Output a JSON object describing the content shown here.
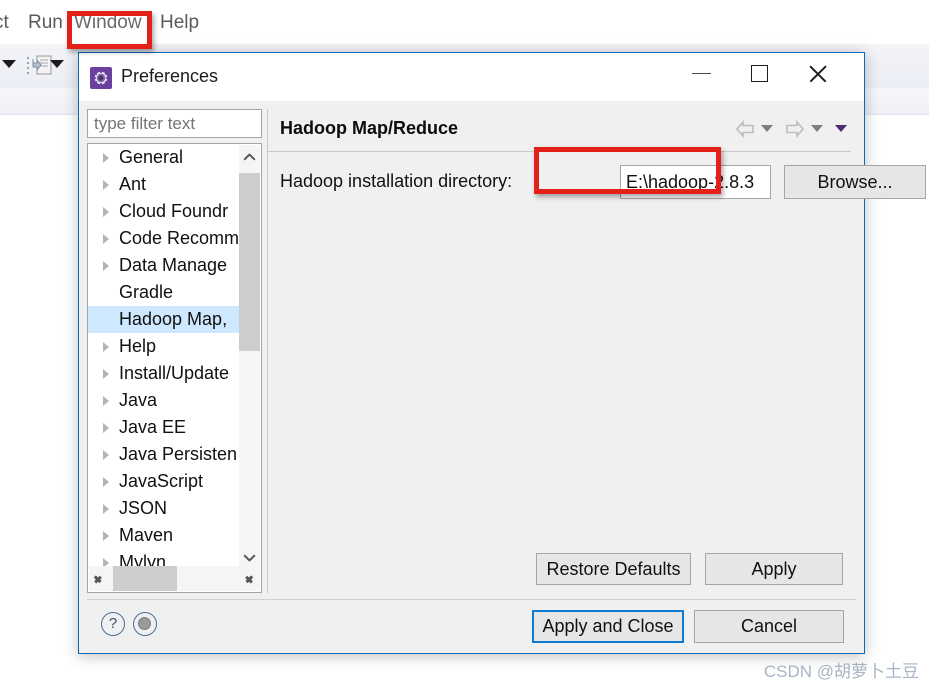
{
  "ide": {
    "menus": [
      {
        "label": "ct",
        "name": "menu-project"
      },
      {
        "label": "Run",
        "name": "menu-run"
      },
      {
        "label": "Window",
        "name": "menu-window"
      },
      {
        "label": "Help",
        "name": "menu-help"
      }
    ]
  },
  "dialog": {
    "title": "Preferences",
    "icon": "gear-icon",
    "window_controls": {
      "minimize": "minimize-icon",
      "maximize": "maximize-icon",
      "close": "close-icon"
    },
    "filter": {
      "placeholder": "type filter text",
      "value": ""
    },
    "tree": {
      "items": [
        {
          "label": "General",
          "expandable": true,
          "selected": false
        },
        {
          "label": "Ant",
          "expandable": true,
          "selected": false
        },
        {
          "label": "Cloud Foundr",
          "expandable": true,
          "selected": false
        },
        {
          "label": "Code Recomm",
          "expandable": true,
          "selected": false
        },
        {
          "label": "Data Manage",
          "expandable": true,
          "selected": false
        },
        {
          "label": "Gradle",
          "expandable": false,
          "selected": false
        },
        {
          "label": "Hadoop Map,",
          "expandable": false,
          "selected": true
        },
        {
          "label": "Help",
          "expandable": true,
          "selected": false
        },
        {
          "label": "Install/Update",
          "expandable": true,
          "selected": false
        },
        {
          "label": "Java",
          "expandable": true,
          "selected": false
        },
        {
          "label": "Java EE",
          "expandable": true,
          "selected": false
        },
        {
          "label": "Java Persisten",
          "expandable": true,
          "selected": false
        },
        {
          "label": "JavaScript",
          "expandable": true,
          "selected": false
        },
        {
          "label": "JSON",
          "expandable": true,
          "selected": false
        },
        {
          "label": "Maven",
          "expandable": true,
          "selected": false
        },
        {
          "label": "Mylyn",
          "expandable": true,
          "selected": false
        }
      ]
    },
    "content": {
      "title": "Hadoop Map/Reduce",
      "nav": {
        "back": "back-arrow-icon",
        "back_dropdown": "chevron-down-icon",
        "forward": "forward-arrow-icon",
        "forward_dropdown": "chevron-down-icon",
        "menu_dropdown": "view-menu-icon"
      },
      "field_label": "Hadoop installation directory:",
      "field_value": "E:\\hadoop-2.8.3",
      "field_placeholder": "",
      "browse_label": "Browse...",
      "restore_defaults_label": "Restore Defaults",
      "apply_label": "Apply"
    },
    "footer": {
      "help_icon": "question-mark-icon",
      "dot_icon": "info-circle-icon",
      "apply_and_close_label": "Apply and Close",
      "cancel_label": "Cancel"
    }
  },
  "annotations": {
    "highlight_color": "#e32119",
    "focus_color": "#0b7bd4",
    "boxes": [
      "window-menu-highlight",
      "directory-field-highlight"
    ]
  },
  "watermark": "CSDN @胡萝卜土豆"
}
